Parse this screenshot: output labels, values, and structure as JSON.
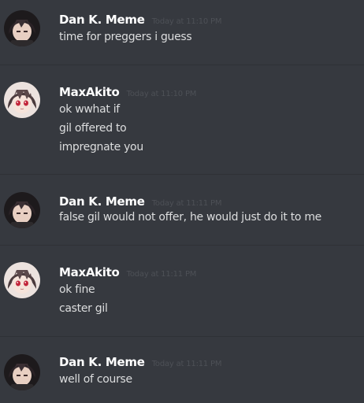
{
  "messages": [
    {
      "username": "Dan K. Meme",
      "timestamp": "Today at 11:10 PM",
      "avatar_icon": "dark-haired-avatar-icon",
      "lines": [
        "time for preggers i guess"
      ]
    },
    {
      "username": "MaxAkito",
      "timestamp": "Today at 11:10 PM",
      "avatar_icon": "pink-eyed-girl-avatar-icon",
      "lines": [
        "ok wwhat if",
        "gil offered to",
        "impregnate you"
      ]
    },
    {
      "username": "Dan K. Meme",
      "timestamp": "Today at 11:11 PM",
      "avatar_icon": "dark-haired-avatar-icon",
      "lines": [
        "false gil would not offer, he would just do it to me"
      ]
    },
    {
      "username": "MaxAkito",
      "timestamp": "Today at 11:11 PM",
      "avatar_icon": "pink-eyed-girl-avatar-icon",
      "lines": [
        "ok fine",
        "caster gil"
      ]
    },
    {
      "username": "Dan K. Meme",
      "timestamp": "Today at 11:11 PM",
      "avatar_icon": "dark-haired-avatar-icon",
      "lines": [
        "well of course"
      ]
    }
  ],
  "colors": {
    "background": "#36393f",
    "username": "#ffffff",
    "message_text": "#dcddde",
    "timestamp": "#4d5056",
    "divider": "#2f3136"
  }
}
